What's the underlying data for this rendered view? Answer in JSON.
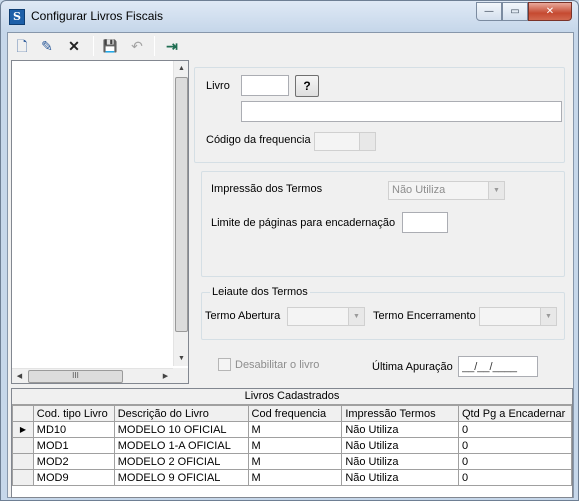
{
  "window": {
    "title": "Configurar Livros Fiscais",
    "app_icon_glyph": "S"
  },
  "titlebar_buttons": {
    "minimize": "—",
    "maximize": "▭",
    "close": "✕"
  },
  "toolbar": [
    {
      "name": "new-icon",
      "glyph": "🗋",
      "enabled": true
    },
    {
      "name": "edit-icon",
      "glyph": "✎",
      "enabled": true
    },
    {
      "name": "delete-icon",
      "glyph": "✕",
      "enabled": true
    },
    {
      "name": "save-icon",
      "glyph": "💾",
      "enabled": false
    },
    {
      "name": "undo-icon",
      "glyph": "↶",
      "enabled": false
    },
    {
      "name": "exit-icon",
      "glyph": "⇥",
      "enabled": true
    }
  ],
  "form": {
    "livro_label": "Livro",
    "livro_code": "",
    "lookup_button": "?",
    "livro_description": "",
    "freq_label": "Código da frequencia",
    "freq_value": "",
    "impressao_label": "Impressão dos Termos",
    "impressao_value": "Não Utiliza",
    "limite_label": "Limite de páginas para encadernação",
    "limite_value": "",
    "leiaute_title": "Leiaute dos Termos",
    "abertura_label": "Termo Abertura",
    "abertura_value": "",
    "encerramento_label": "Termo Encerramento",
    "encerramento_value": "",
    "desabilitar_label": "Desabilitar o livro",
    "ultima_label": "Última Apuração",
    "ultima_value": "__/__/____"
  },
  "grid": {
    "caption": "Livros Cadastrados",
    "columns": [
      "Cod. tipo Livro",
      "Descrição do Livro",
      "Cod frequencia",
      "Impressão Termos",
      "Qtd Pg a Encadernar"
    ],
    "rows": [
      [
        "MD10",
        "MODELO 10 OFICIAL",
        "M",
        "Não Utiliza",
        "0"
      ],
      [
        "MOD1",
        "MODELO 1-A OFICIAL",
        "M",
        "Não Utiliza",
        "0"
      ],
      [
        "MOD2",
        "MODELO 2 OFICIAL",
        "M",
        "Não Utiliza",
        "0"
      ],
      [
        "MOD9",
        "MODELO 9 OFICIAL",
        "M",
        "Não Utiliza",
        "0"
      ]
    ],
    "current_row_indicator": "▶"
  },
  "scroll": {
    "up": "▲",
    "down": "▼",
    "left": "◀",
    "right": "▶",
    "grip": "III"
  }
}
